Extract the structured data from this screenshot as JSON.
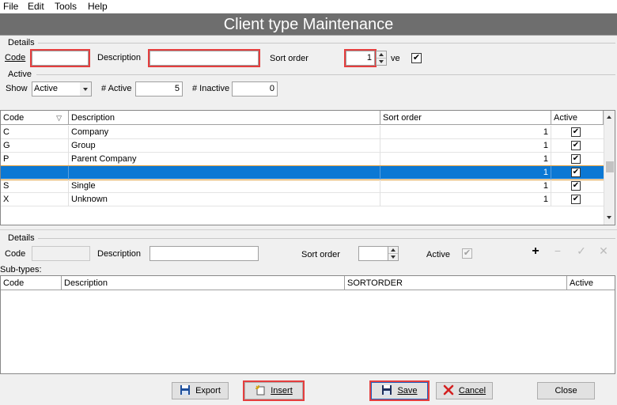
{
  "menu": {
    "file": "File",
    "edit": "Edit",
    "tools": "Tools",
    "help": "Help"
  },
  "title": "Client type Maintenance",
  "details_top": {
    "group": "Details",
    "code_label": "Code",
    "code_value": "",
    "description_label": "Description",
    "description_value": "",
    "sort_label": "Sort order",
    "sort_value": "1",
    "active_partial": "ve",
    "active_checked": "✔"
  },
  "active_filter": {
    "group": "Active",
    "show_label": "Show",
    "show_value": "Active",
    "num_active_label": "# Active",
    "num_active_value": "5",
    "num_inactive_label": "# Inactive",
    "num_inactive_value": "0"
  },
  "grid": {
    "headers": {
      "code": "Code",
      "description": "Description",
      "sort": "Sort order",
      "active": "Active"
    },
    "rows": [
      {
        "code": "C",
        "description": "Company",
        "sort": "1",
        "active": "✔"
      },
      {
        "code": "G",
        "description": "Group",
        "sort": "1",
        "active": "✔"
      },
      {
        "code": "P",
        "description": "Parent Company",
        "sort": "1",
        "active": "✔"
      },
      {
        "code": "",
        "description": "",
        "sort": "1",
        "active": "✔"
      },
      {
        "code": "S",
        "description": "Single",
        "sort": "1",
        "active": "✔"
      },
      {
        "code": "X",
        "description": "Unknown",
        "sort": "1",
        "active": "✔"
      }
    ]
  },
  "details_bottom": {
    "group": "Details",
    "code_label": "Code",
    "description_label": "Description",
    "sort_label": "Sort order",
    "active_label": "Active",
    "active_checked": "✔",
    "subtypes_label": "Sub-types:"
  },
  "subgrid": {
    "headers": {
      "code": "Code",
      "description": "Description",
      "sortorder": "SORTORDER",
      "active": "Active"
    }
  },
  "buttons": {
    "export": "Export",
    "insert": "Insert",
    "save": "Save",
    "cancel": "Cancel",
    "close": "Close"
  },
  "colors": {
    "selection": "#0b78d4",
    "highlight": "#e53e3e",
    "title_bg": "#6e6e6e"
  }
}
